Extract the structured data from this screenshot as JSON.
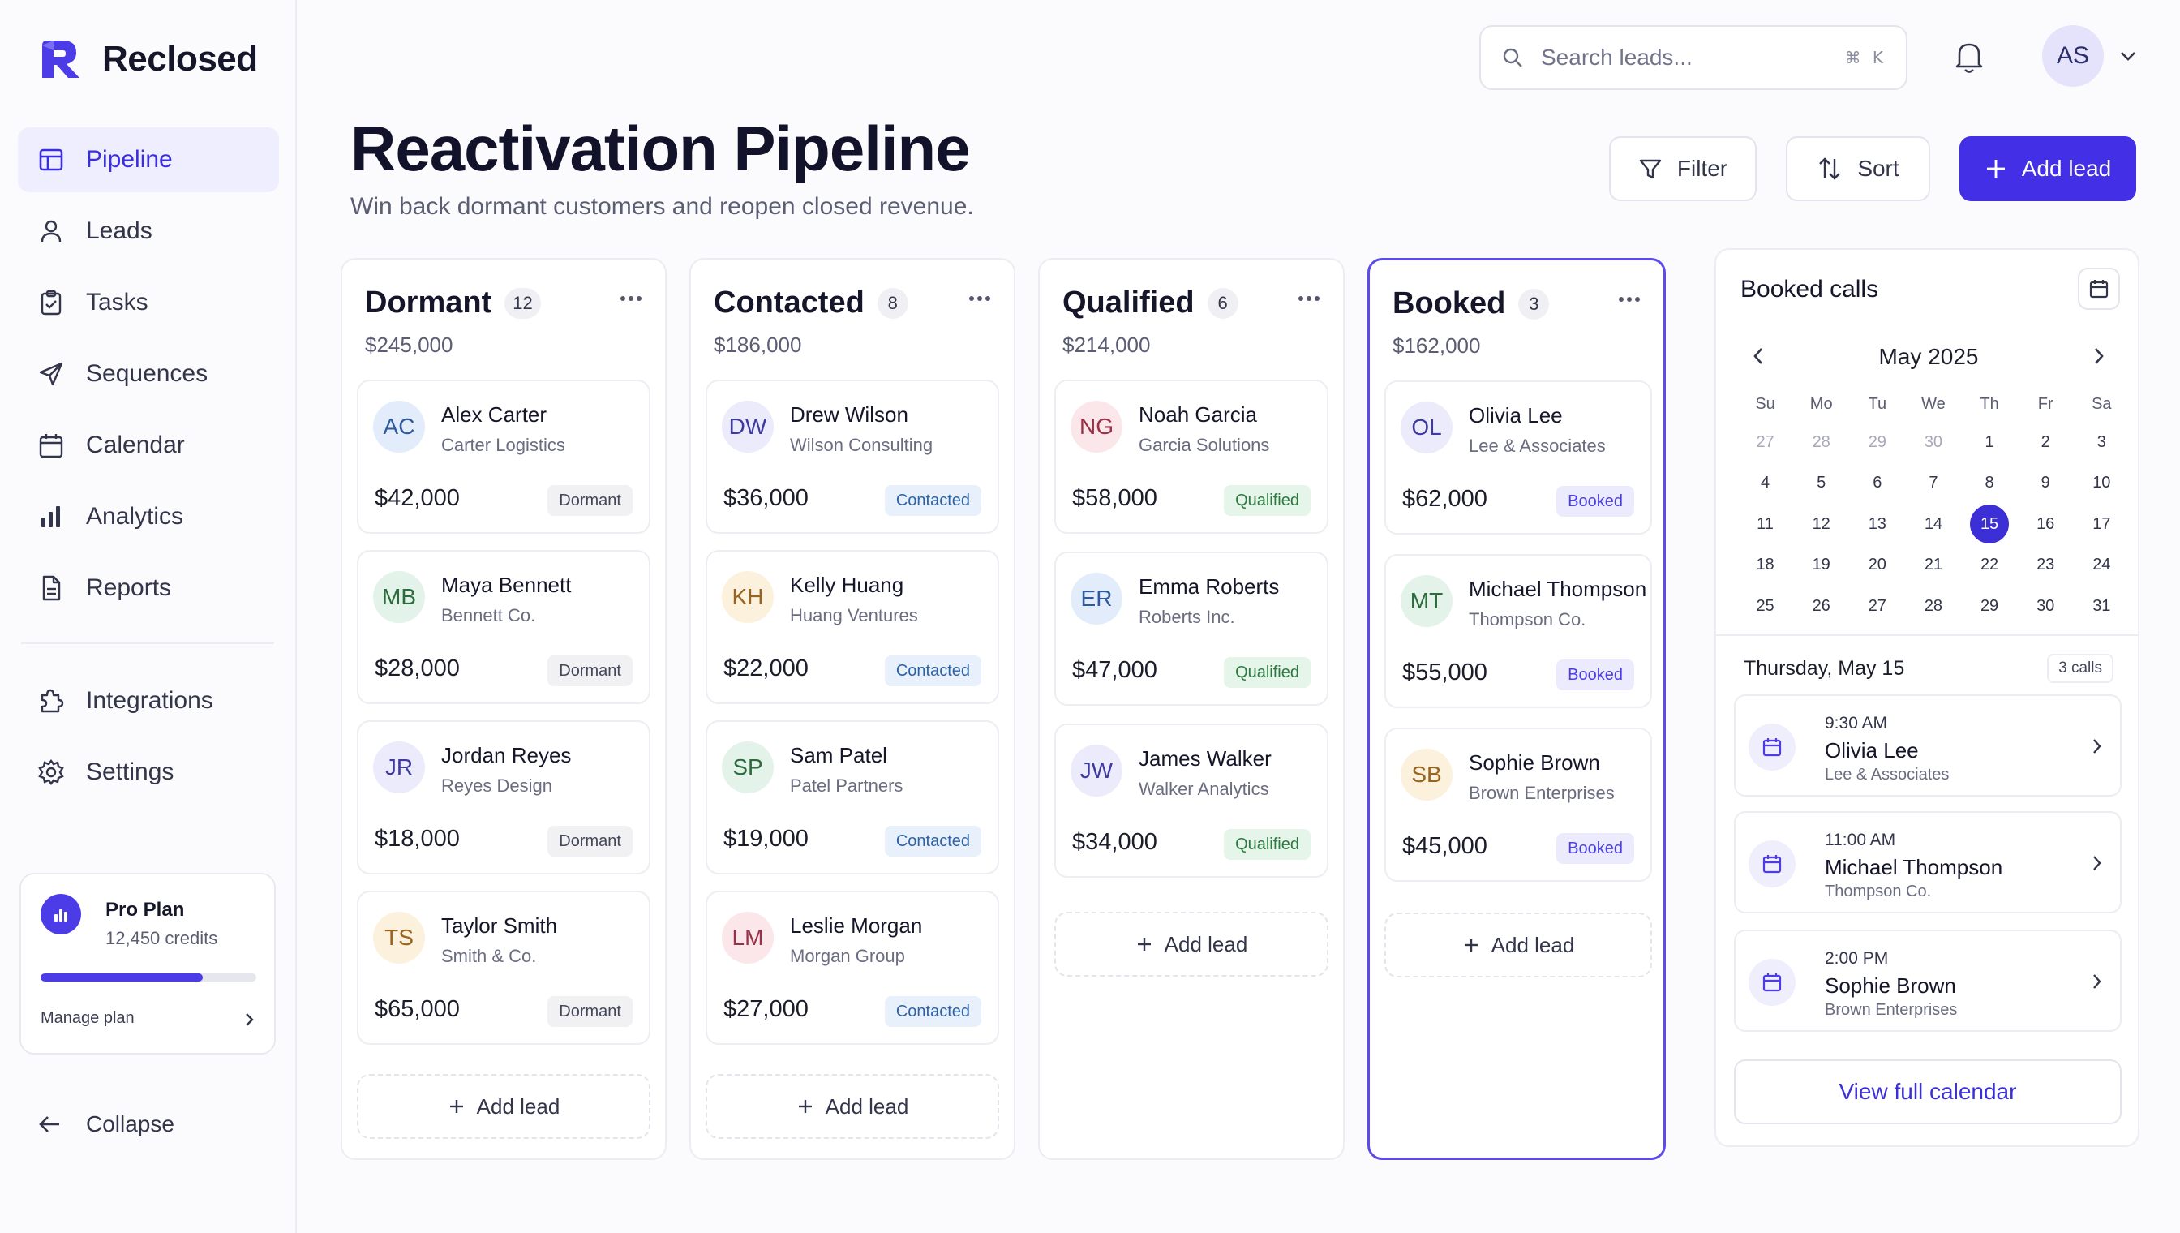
{
  "brand": {
    "name": "Reclosed",
    "color": "#4b3ce8"
  },
  "nav": {
    "primary": [
      {
        "label": "Pipeline",
        "icon": "layout-icon",
        "active": true
      },
      {
        "label": "Leads",
        "icon": "user-icon"
      },
      {
        "label": "Tasks",
        "icon": "clipboard-check-icon"
      },
      {
        "label": "Sequences",
        "icon": "send-icon"
      },
      {
        "label": "Calendar",
        "icon": "calendar-icon"
      },
      {
        "label": "Analytics",
        "icon": "bar-chart-icon"
      },
      {
        "label": "Reports",
        "icon": "file-icon"
      }
    ],
    "secondary": [
      {
        "label": "Integrations",
        "icon": "puzzle-icon"
      },
      {
        "label": "Settings",
        "icon": "gear-icon"
      }
    ],
    "collapse_label": "Collapse"
  },
  "plan": {
    "name": "Pro Plan",
    "credits": "12,450 credits",
    "usage_fraction": 0.75,
    "manage_label": "Manage plan"
  },
  "search": {
    "placeholder": "Search leads...",
    "shortcut": "⌘ K"
  },
  "user": {
    "initials": "AS"
  },
  "header": {
    "title": "Reactivation Pipeline",
    "subtitle": "Win back dormant customers and reopen closed revenue.",
    "filter_label": "Filter",
    "sort_label": "Sort",
    "add_label": "Add lead"
  },
  "columns": [
    {
      "title": "Dormant",
      "count": "12",
      "total": "$245,000",
      "badge_class": "badge-dormant",
      "cards": [
        {
          "initials": "AC",
          "name": "Alex Carter",
          "company": "Carter Logistics",
          "amount": "$42,000",
          "status": "Dormant",
          "avatar": "av-blue"
        },
        {
          "initials": "MB",
          "name": "Maya Bennett",
          "company": "Bennett Co.",
          "amount": "$28,000",
          "status": "Dormant",
          "avatar": "av-green"
        },
        {
          "initials": "JR",
          "name": "Jordan Reyes",
          "company": "Reyes Design",
          "amount": "$18,000",
          "status": "Dormant",
          "avatar": "av-purple"
        },
        {
          "initials": "TS",
          "name": "Taylor Smith",
          "company": "Smith & Co.",
          "amount": "$65,000",
          "status": "Dormant",
          "avatar": "av-amber"
        }
      ],
      "add_label": "Add lead"
    },
    {
      "title": "Contacted",
      "count": "8",
      "total": "$186,000",
      "badge_class": "badge-contacted",
      "cards": [
        {
          "initials": "DW",
          "name": "Drew Wilson",
          "company": "Wilson Consulting",
          "amount": "$36,000",
          "status": "Contacted",
          "avatar": "av-purple"
        },
        {
          "initials": "KH",
          "name": "Kelly Huang",
          "company": "Huang Ventures",
          "amount": "$22,000",
          "status": "Contacted",
          "avatar": "av-amber"
        },
        {
          "initials": "SP",
          "name": "Sam Patel",
          "company": "Patel Partners",
          "amount": "$19,000",
          "status": "Contacted",
          "avatar": "av-green"
        },
        {
          "initials": "LM",
          "name": "Leslie Morgan",
          "company": "Morgan Group",
          "amount": "$27,000",
          "status": "Contacted",
          "avatar": "av-pink"
        }
      ],
      "add_label": "Add lead"
    },
    {
      "title": "Qualified",
      "count": "6",
      "total": "$214,000",
      "badge_class": "badge-qualified",
      "cards": [
        {
          "initials": "NG",
          "name": "Noah Garcia",
          "company": "Garcia Solutions",
          "amount": "$58,000",
          "status": "Qualified",
          "avatar": "av-pink"
        },
        {
          "initials": "ER",
          "name": "Emma Roberts",
          "company": "Roberts Inc.",
          "amount": "$47,000",
          "status": "Qualified",
          "avatar": "av-blue"
        },
        {
          "initials": "JW",
          "name": "James Walker",
          "company": "Walker Analytics",
          "amount": "$34,000",
          "status": "Qualified",
          "avatar": "av-purple"
        }
      ],
      "add_label": "Add lead"
    },
    {
      "title": "Booked",
      "count": "3",
      "total": "$162,000",
      "badge_class": "badge-booked",
      "cards": [
        {
          "initials": "OL",
          "name": "Olivia Lee",
          "company": "Lee & Associates",
          "amount": "$62,000",
          "status": "Booked",
          "avatar": "av-purple"
        },
        {
          "initials": "MT",
          "name": "Michael Thompson",
          "company": "Thompson Co.",
          "amount": "$55,000",
          "status": "Booked",
          "avatar": "av-green"
        },
        {
          "initials": "SB",
          "name": "Sophie Brown",
          "company": "Brown Enterprises",
          "amount": "$45,000",
          "status": "Booked",
          "avatar": "av-amber"
        }
      ],
      "add_label": "Add lead"
    }
  ],
  "calls": {
    "title": "Booked calls",
    "calendar": {
      "month": "May 2025",
      "weekdays": [
        "Su",
        "Mo",
        "Tu",
        "We",
        "Th",
        "Fr",
        "Sa"
      ],
      "days": [
        {
          "d": "27",
          "muted": true
        },
        {
          "d": "28",
          "muted": true
        },
        {
          "d": "29",
          "muted": true
        },
        {
          "d": "30",
          "muted": true
        },
        {
          "d": "1"
        },
        {
          "d": "2"
        },
        {
          "d": "3"
        },
        {
          "d": "4"
        },
        {
          "d": "5"
        },
        {
          "d": "6"
        },
        {
          "d": "7"
        },
        {
          "d": "8"
        },
        {
          "d": "9"
        },
        {
          "d": "10"
        },
        {
          "d": "11"
        },
        {
          "d": "12"
        },
        {
          "d": "13"
        },
        {
          "d": "14"
        },
        {
          "d": "15",
          "selected": true
        },
        {
          "d": "16"
        },
        {
          "d": "17"
        },
        {
          "d": "18"
        },
        {
          "d": "19"
        },
        {
          "d": "20"
        },
        {
          "d": "21"
        },
        {
          "d": "22"
        },
        {
          "d": "23"
        },
        {
          "d": "24"
        },
        {
          "d": "25"
        },
        {
          "d": "26"
        },
        {
          "d": "27"
        },
        {
          "d": "28"
        },
        {
          "d": "29"
        },
        {
          "d": "30"
        },
        {
          "d": "31"
        }
      ]
    },
    "day_label": "Thursday, May 15",
    "day_count": "3 calls",
    "items": [
      {
        "time": "9:30 AM",
        "name": "Olivia Lee",
        "company": "Lee & Associates"
      },
      {
        "time": "11:00 AM",
        "name": "Michael Thompson",
        "company": "Thompson Co."
      },
      {
        "time": "2:00 PM",
        "name": "Sophie Brown",
        "company": "Brown Enterprises"
      }
    ],
    "view_all_label": "View full calendar"
  }
}
